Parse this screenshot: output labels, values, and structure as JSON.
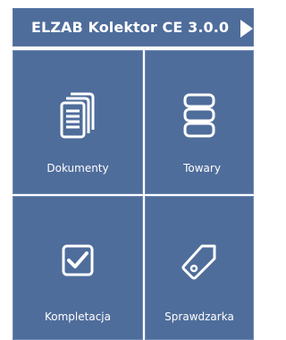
{
  "header": {
    "title": "ELZAB Kolektor CE 3.0.0"
  },
  "tiles": [
    {
      "label": "Dokumenty",
      "icon": "documents-icon"
    },
    {
      "label": "Towary",
      "icon": "database-stack-icon"
    },
    {
      "label": "Kompletacja",
      "icon": "checkbox-icon"
    },
    {
      "label": "Sprawdzarka",
      "icon": "price-tag-icon"
    }
  ],
  "colors": {
    "tile_background": "#4f6d9b",
    "text": "#ffffff"
  }
}
